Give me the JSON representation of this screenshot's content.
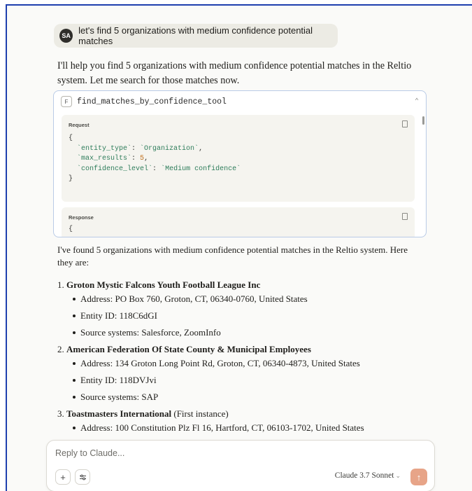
{
  "user_message": {
    "avatar_initials": "SA",
    "text": "let's find 5 organizations with medium confidence potential matches"
  },
  "assistant_intro": "I'll help you find 5 organizations with medium confidence potential matches in the Reltio system. Let me search for those matches now.",
  "tool_call": {
    "badge": "F",
    "name": "find_matches_by_confidence_tool",
    "chevron_icon": "chevron-up-icon",
    "request_title": "Request",
    "request_lines": {
      "open": "{",
      "entity_type_key": "`entity_type`",
      "entity_type_value": "`Organization`",
      "max_results_key": "`max_results`",
      "max_results_value": "5",
      "confidence_key": "`confidence_level`",
      "confidence_value": "`Medium confidence`",
      "close": "}"
    },
    "response_title": "Response",
    "response_first_line": "{"
  },
  "answer": {
    "lead": "I've found 5 organizations with medium confidence potential matches in the Reltio system. Here they are:",
    "orgs": [
      {
        "number": "1.",
        "name": "Groton Mystic Falcons Youth Football League Inc",
        "suffix": "",
        "address": "Address: PO Box 760, Groton, CT, 06340-0760, United States",
        "entity_id": "Entity ID: 118C6dGI",
        "sources": "Source systems: Salesforce, ZoomInfo"
      },
      {
        "number": "2.",
        "name": "American Federation Of State County & Municipal Employees",
        "suffix": "",
        "address": "Address: 134 Groton Long Point Rd, Groton, CT, 06340-4873, United States",
        "entity_id": "Entity ID: 118DVJvi",
        "sources": "Source systems: SAP"
      },
      {
        "number": "3.",
        "name": "Toastmasters International",
        "suffix": " (First instance)",
        "address": "Address: 100 Constitution Plz Fl 16, Hartford, CT, 06103-1702, United States"
      }
    ]
  },
  "composer": {
    "placeholder": "Reply to Claude...",
    "plus_label": "+",
    "settings_icon": "sliders-icon",
    "model_name": "Claude 3.7 Sonnet",
    "send_icon": "arrow-up-icon"
  },
  "colors": {
    "frame_border": "#1e3fae",
    "send_button": "#e7a488",
    "tool_border": "#b9cbe6"
  }
}
